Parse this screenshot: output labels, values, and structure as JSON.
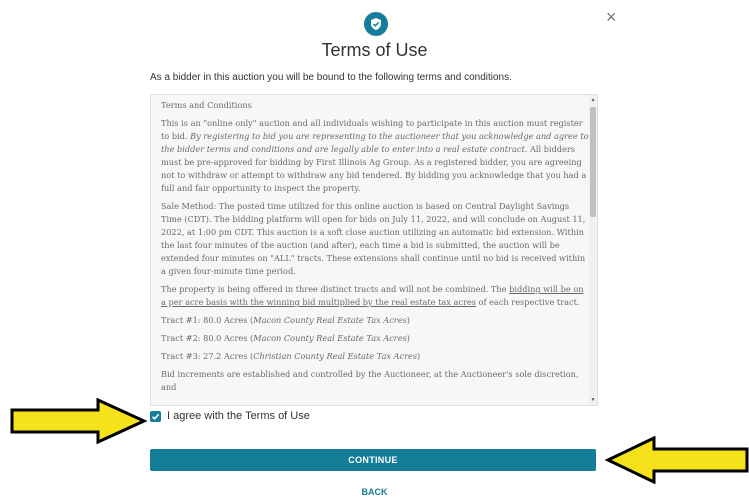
{
  "modal": {
    "close_symbol": "×",
    "title": "Terms of Use",
    "intro": "As a bidder in this auction you will be bound to the following terms and conditions.",
    "icon": "shield-check-icon",
    "accent_color": "#157d97"
  },
  "terms": {
    "heading": "Terms and Conditions",
    "p1_a": "This is an \"online only\" auction and all individuals wishing to participate in this auction must register to bid. ",
    "p1_b": "By registering to bid you are representing to the auctioneer that you acknowledge and agree to the bidder terms and conditions and are legally able to enter into a real estate contract.",
    "p1_c": " All bidders must be pre-approved for bidding by First Illinois Ag Group.  As a registered bidder, you are agreeing not to withdraw or attempt to withdraw any bid tendered.  By bidding you acknowledge that you had a full and fair opportunity to inspect the property.",
    "p2": "Sale Method: The posted time utilized for this online auction is based on Central Daylight Savings Time (CDT). The bidding platform will open for bids on July 11, 2022, and will conclude on August 11, 2022, at 1:00 pm CDT. This auction is a soft close auction utilizing an automatic bid extension. Within the last four minutes of the auction (and after), each time a bid is submitted, the auction will be extended four minutes on \"ALL\" tracts. These extensions shall continue until no bid is received within a given four-minute time period.",
    "p3_a": "The property is being offered in three distinct tracts and will not be combined. The ",
    "p3_b": "bidding will be on a per acre basis with the winning bid multiplied by the real estate tax acres",
    "p3_c": " of each respective tract.",
    "t1_a": "Tract #1: 80.0 Acres (",
    "t1_b": "Macon County Real Estate Tax Acres",
    "t1_c": ")",
    "t2_a": "Tract #2: 80.0 Acres (",
    "t2_b": "Macon County Real Estate Tax Acres",
    "t2_c": ")",
    "t3_a": "Tract #3: 27.2 Acres (",
    "t3_b": "Christian County Real Estate Tax Acres",
    "t3_c": ")",
    "p4": "Bid increments are established and controlled by the Auctioneer, at the Auctioneer's sole discretion, and"
  },
  "agree": {
    "checked": true,
    "label": "I agree with the Terms of Use"
  },
  "buttons": {
    "continue_label": "CONTINUE",
    "back_label": "BACK"
  },
  "annotation": {
    "arrow_color": "#f5e21b"
  }
}
